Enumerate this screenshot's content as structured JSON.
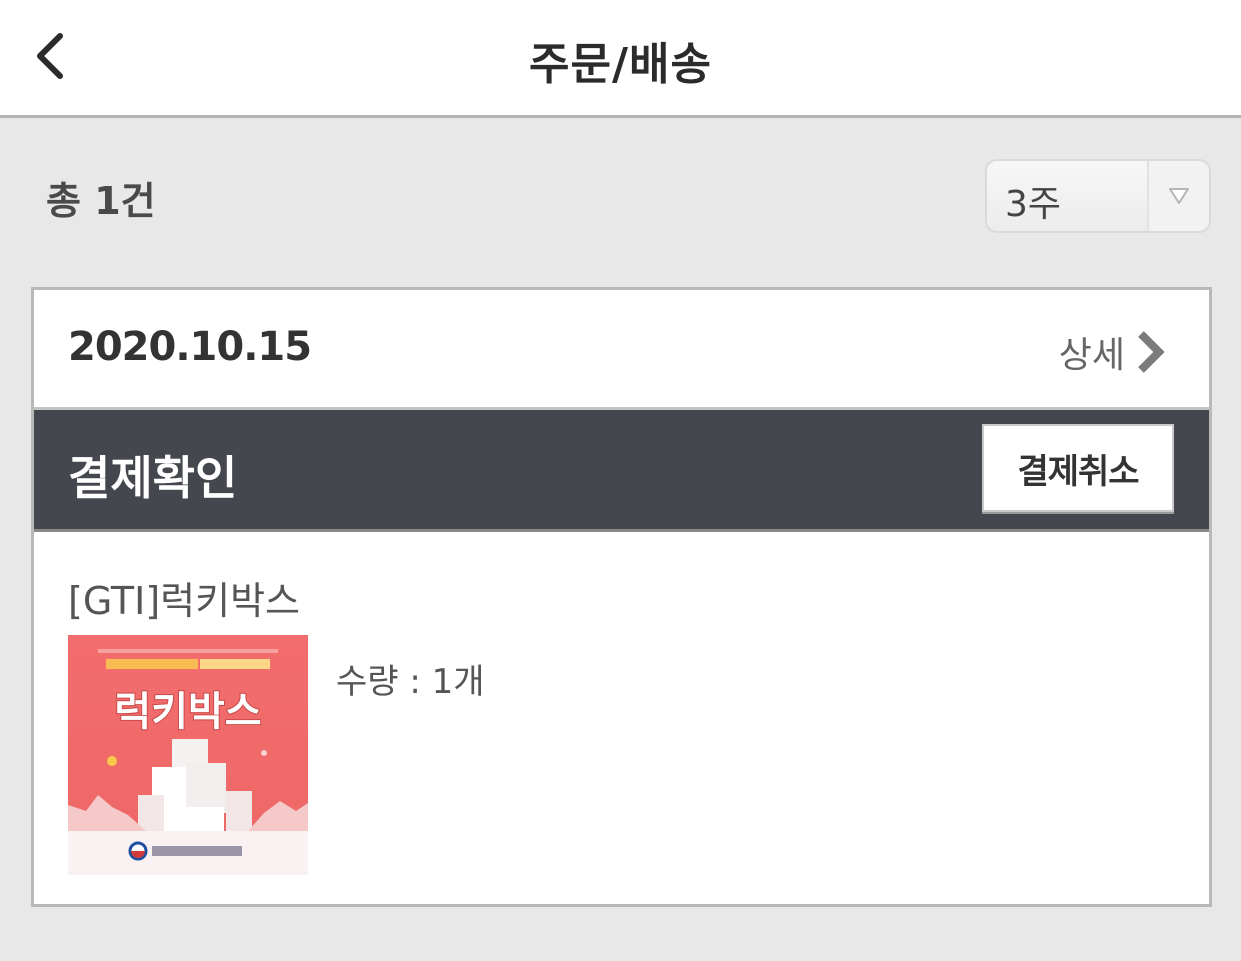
{
  "header": {
    "title": "주문/배송",
    "back_icon": "chevron-left-icon"
  },
  "summary": {
    "total_label": "총 1건",
    "period": {
      "selected": "3주",
      "arrow_icon": "triangle-down-icon"
    }
  },
  "order": {
    "date": "2020.10.15",
    "detail_label": "상세",
    "detail_icon": "chevron-right-icon",
    "status": "결제확인",
    "cancel_label": "결제취소",
    "product": {
      "name": "[GTI]럭키박스",
      "thumb_title": "럭키박스",
      "quantity_text": "수량 : 1개"
    }
  },
  "colors": {
    "status_bar": "#44474e",
    "thumb_bg": "#ef6a6a",
    "page_bg": "#e8e8e8"
  }
}
